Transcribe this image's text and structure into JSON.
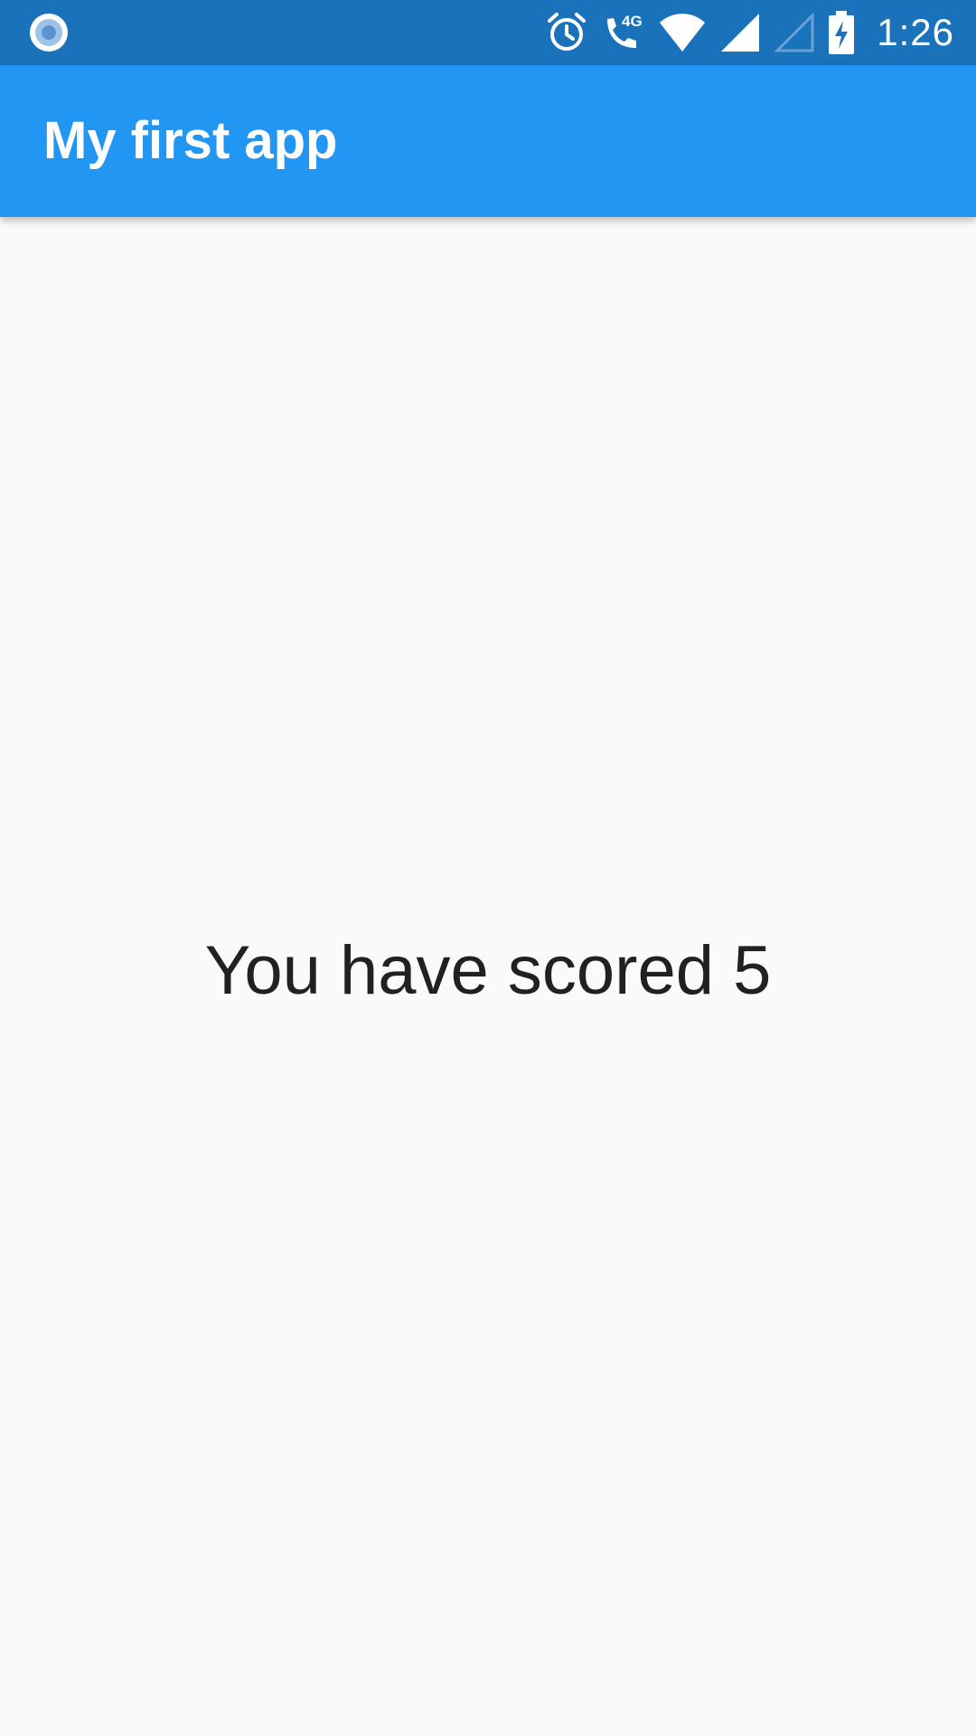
{
  "status_bar": {
    "time": "1:26",
    "network_badge": "4G",
    "icons": [
      "notification-dot-icon",
      "alarm-icon",
      "phone-call-icon",
      "wifi-icon",
      "signal-full-icon",
      "signal-empty-icon",
      "battery-charging-icon"
    ],
    "background_color": "#1a73ba"
  },
  "app_bar": {
    "title": "My first app",
    "background_color": "#2196f3"
  },
  "main": {
    "score_text": "You have scored 5",
    "background_color": "#fafafa",
    "text_color": "#212121"
  }
}
